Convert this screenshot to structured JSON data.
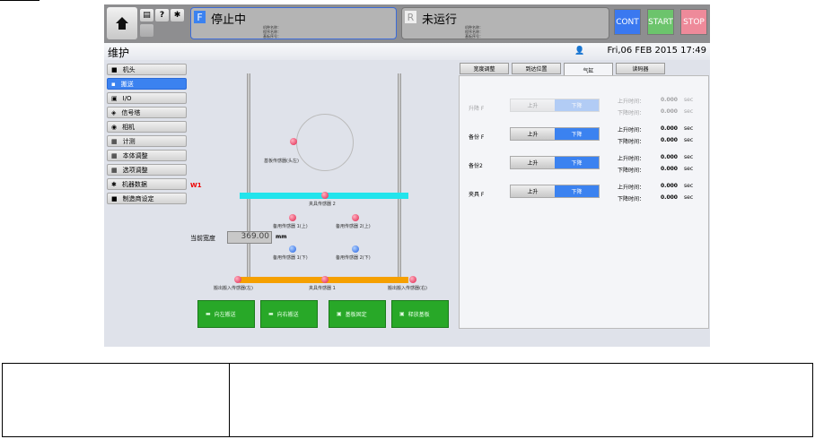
{
  "header": {
    "home": "home-icon",
    "status_f": {
      "badge": "F",
      "text": "停止中",
      "lines": [
        "机种名称：",
        "程序名称：",
        "基板序号："
      ]
    },
    "status_r": {
      "badge": "R",
      "text": "未运行",
      "lines": [
        "机种名称：",
        "程序名称：",
        "基板序号："
      ]
    },
    "cont": "CONT",
    "start": "START",
    "stop": "STOP",
    "colors": {
      "cont": "#3a78f0",
      "start": "#6cc46c",
      "stop": "#ee8a9a"
    }
  },
  "title": {
    "text": "维护",
    "datetime": "Fri,06 FEB 2015  17:49"
  },
  "sidebar": {
    "items": [
      {
        "label": "机头"
      },
      {
        "label": "搬送"
      },
      {
        "label": "I/O"
      },
      {
        "label": "信号塔"
      },
      {
        "label": "相机"
      },
      {
        "label": "计测"
      },
      {
        "label": "本体调整"
      },
      {
        "label": "选项调整"
      },
      {
        "label": "机器数据"
      },
      {
        "label": "制造商设定"
      }
    ],
    "active": 1
  },
  "diagram": {
    "w1": "W1",
    "width_label": "当前宽度",
    "width_value": "369.00",
    "width_unit": "mm",
    "sensors": {
      "board_head": "基板传感器(头左)",
      "clamp2": "夹具传感器 2",
      "spare1_up": "备用传感器 1(上)",
      "spare2_up": "备用传感器 2(上)",
      "spare1_down": "备用传感器 1(下)",
      "spare2_down": "备用传感器 2(下)",
      "io_left": "搬出搬入传感器(左)",
      "clamp1": "夹具传感器 1",
      "io_right": "搬出搬入传感器(右)"
    },
    "buttons": [
      "向左搬送",
      "向右搬送",
      "基板固定",
      "释放基板"
    ]
  },
  "tabs": [
    "宽度调整",
    "到达位置",
    "气缸",
    "读码器"
  ],
  "cylinders": {
    "up": "上升",
    "down": "下降",
    "up_time": "上升时间：",
    "down_time": "下降时间：",
    "unit": "sec",
    "rows": [
      {
        "name": "升降 F",
        "up_val": "0.000",
        "down_val": "0.000"
      },
      {
        "name": "备份 F",
        "up_val": "0.000",
        "down_val": "0.000"
      },
      {
        "name": "备份2",
        "up_val": "0.000",
        "down_val": "0.000"
      },
      {
        "name": "夹具 F",
        "up_val": "0.000",
        "down_val": "0.000"
      }
    ]
  }
}
